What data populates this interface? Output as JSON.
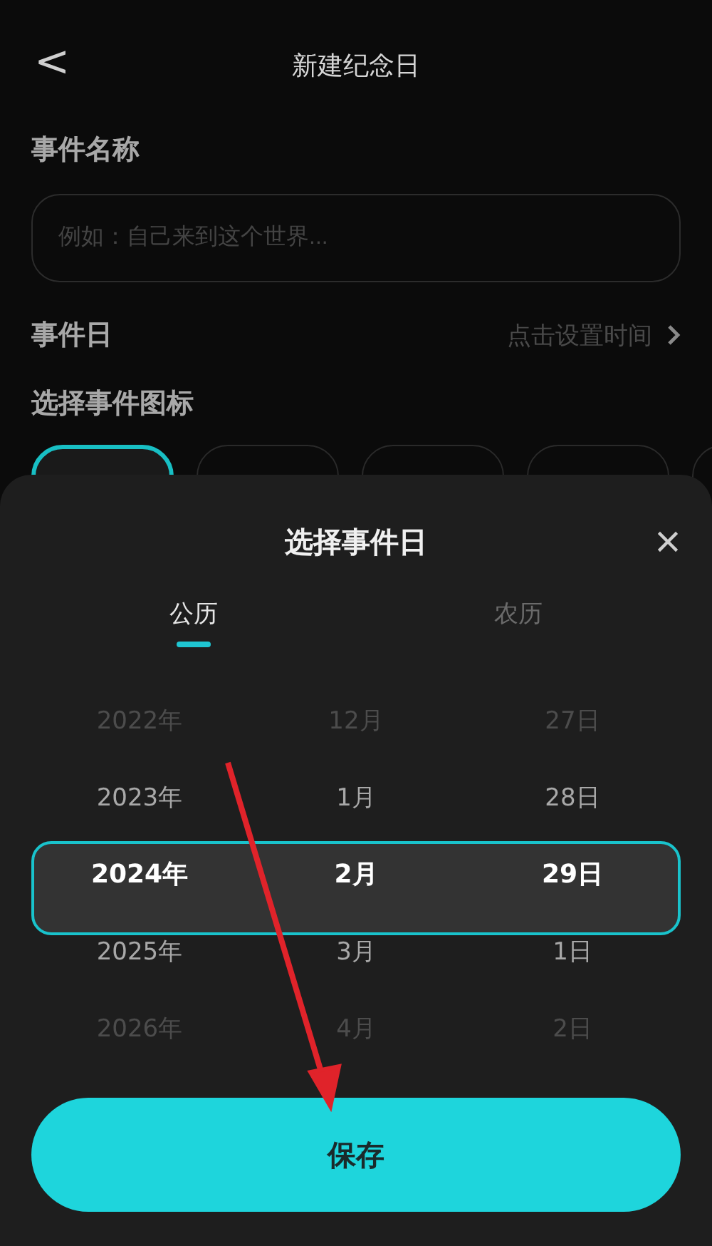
{
  "header": {
    "back": "<",
    "title": "新建纪念日"
  },
  "form": {
    "name_label": "事件名称",
    "name_placeholder": "例如：自己来到这个世界...",
    "date_label": "事件日",
    "date_hint": "点击设置时间",
    "icon_label": "选择事件图标",
    "icons": [
      {
        "selected": true
      },
      {
        "selected": false
      },
      {
        "selected": false
      },
      {
        "selected": false
      },
      {
        "selected": false
      }
    ]
  },
  "sheet": {
    "title": "选择事件日",
    "tabs": [
      {
        "label": "公历",
        "selected": true
      },
      {
        "label": "农历",
        "selected": false
      }
    ],
    "columns": [
      {
        "items": [
          {
            "label": "2022年",
            "selected": false
          },
          {
            "label": "2023年",
            "selected": false
          },
          {
            "label": "2024年",
            "selected": true
          },
          {
            "label": "2025年",
            "selected": false
          },
          {
            "label": "2026年",
            "selected": false
          }
        ]
      },
      {
        "items": [
          {
            "label": "12月",
            "selected": false
          },
          {
            "label": "1月",
            "selected": false
          },
          {
            "label": "2月",
            "selected": true
          },
          {
            "label": "3月",
            "selected": false
          },
          {
            "label": "4月",
            "selected": false
          }
        ]
      },
      {
        "items": [
          {
            "label": "27日",
            "selected": false
          },
          {
            "label": "28日",
            "selected": false
          },
          {
            "label": "29日",
            "selected": true
          },
          {
            "label": "1日",
            "selected": false
          },
          {
            "label": "2日",
            "selected": false
          }
        ]
      }
    ],
    "save": "保存"
  }
}
